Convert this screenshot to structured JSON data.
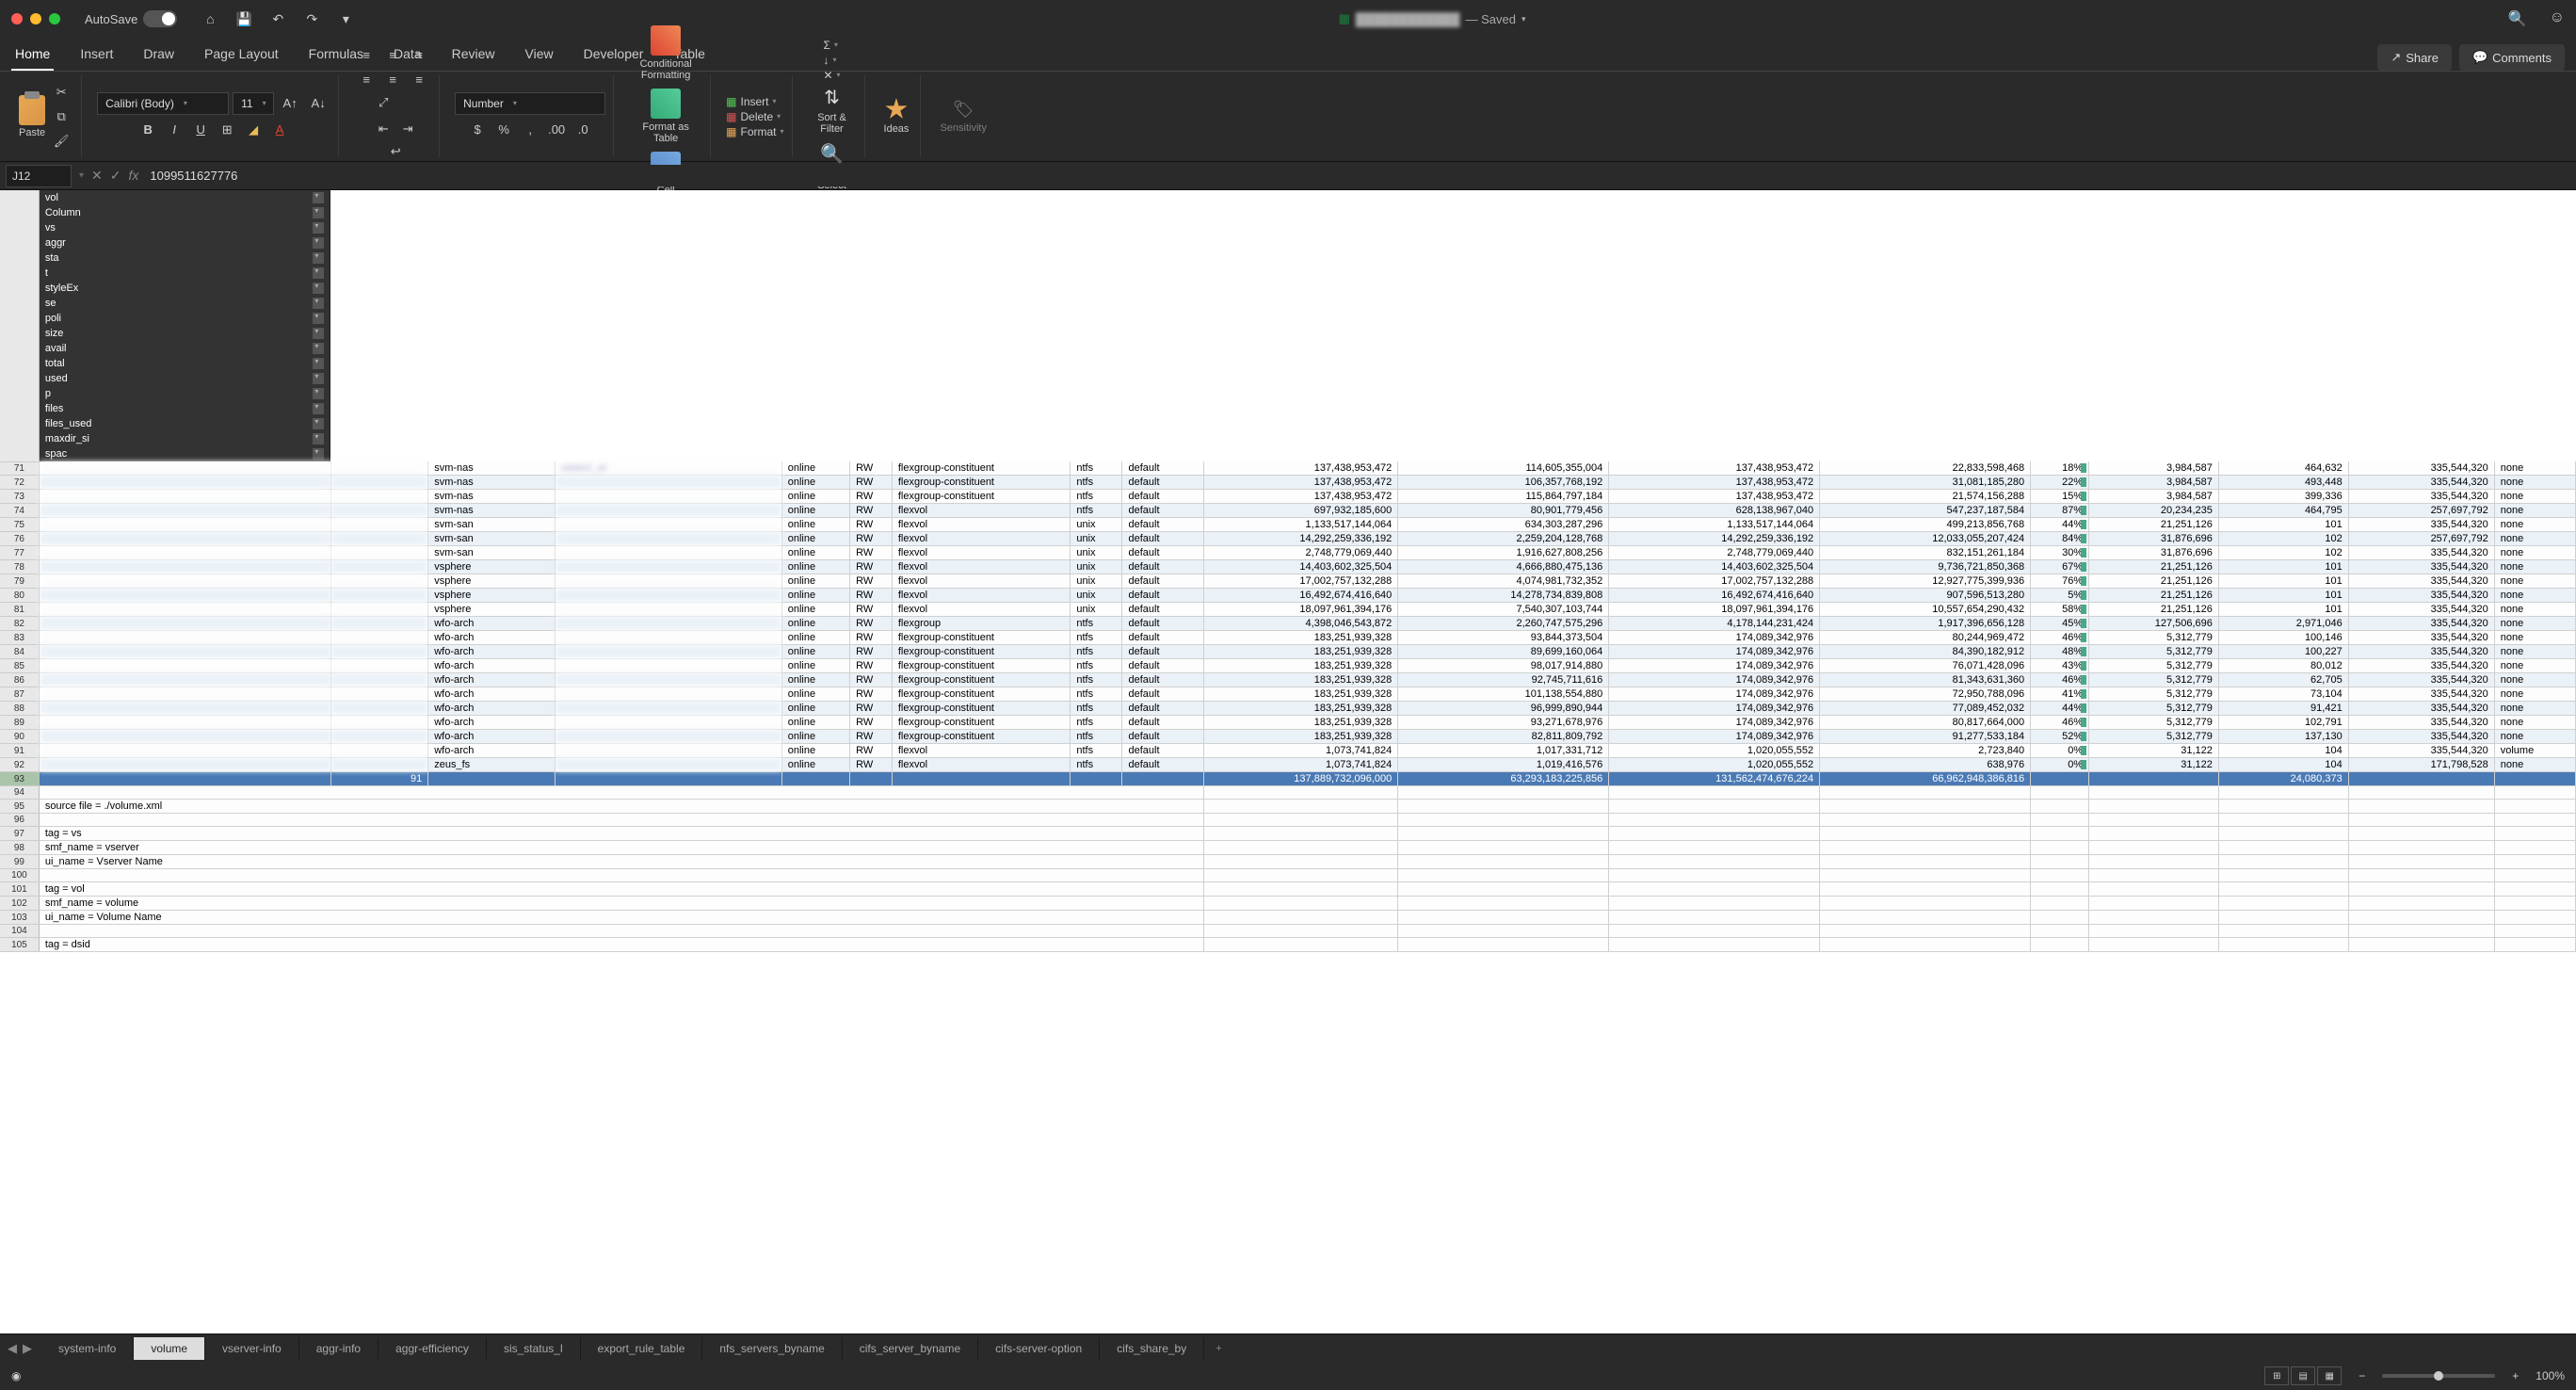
{
  "titlebar": {
    "autosave_label": "AutoSave",
    "doc_status": "— Saved"
  },
  "ribbon_tabs": [
    "Home",
    "Insert",
    "Draw",
    "Page Layout",
    "Formulas",
    "Data",
    "Review",
    "View",
    "Developer",
    "Table"
  ],
  "ribbon_right": {
    "share": "Share",
    "comments": "Comments"
  },
  "ribbon": {
    "paste": "Paste",
    "font_name": "Calibri (Body)",
    "font_size": "11",
    "number_format": "Number",
    "conditional_formatting": "Conditional Formatting",
    "format_as_table": "Format as Table",
    "cell_styles": "Cell Styles",
    "insert": "Insert",
    "delete": "Delete",
    "format": "Format",
    "sort_filter": "Sort & Filter",
    "find_select": "Find & Select",
    "ideas": "Ideas",
    "sensitivity": "Sensitivity"
  },
  "formula_bar": {
    "name_box": "J12",
    "formula": "1099511627776"
  },
  "columns": [
    "vol",
    "Column",
    "vs",
    "aggr",
    "sta",
    "t",
    "styleEx",
    "se",
    "poli",
    "size",
    "avail",
    "total",
    "used",
    "p",
    "files",
    "files_used",
    "maxdir_si",
    "spac"
  ],
  "rows": [
    {
      "n": 71,
      "vs": "svm-nas",
      "aggr": "sata02_at",
      "sta": "online",
      "t": "RW",
      "style": "flexgroup-constituent",
      "se": "ntfs",
      "poli": "default",
      "size": "137,438,953,472",
      "avail": "114,605,355,004",
      "total": "137,438,953,472",
      "used": "22,833,598,468",
      "p": "18%",
      "files": "3,984,587",
      "fu": "464,632",
      "maxdir": "335,544,320",
      "spac": "none"
    },
    {
      "n": 72,
      "vs": "svm-nas",
      "sta": "online",
      "t": "RW",
      "style": "flexgroup-constituent",
      "se": "ntfs",
      "poli": "default",
      "size": "137,438,953,472",
      "avail": "106,357,768,192",
      "total": "137,438,953,472",
      "used": "31,081,185,280",
      "p": "22%",
      "files": "3,984,587",
      "fu": "493,448",
      "maxdir": "335,544,320",
      "spac": "none"
    },
    {
      "n": 73,
      "vs": "svm-nas",
      "sta": "online",
      "t": "RW",
      "style": "flexgroup-constituent",
      "se": "ntfs",
      "poli": "default",
      "size": "137,438,953,472",
      "avail": "115,864,797,184",
      "total": "137,438,953,472",
      "used": "21,574,156,288",
      "p": "15%",
      "files": "3,984,587",
      "fu": "399,336",
      "maxdir": "335,544,320",
      "spac": "none"
    },
    {
      "n": 74,
      "vs": "svm-nas",
      "sta": "online",
      "t": "RW",
      "style": "flexvol",
      "se": "ntfs",
      "poli": "default",
      "size": "697,932,185,600",
      "avail": "80,901,779,456",
      "total": "628,138,967,040",
      "used": "547,237,187,584",
      "p": "87%",
      "files": "20,234,235",
      "fu": "464,795",
      "maxdir": "257,697,792",
      "spac": "none"
    },
    {
      "n": 75,
      "vs": "svm-san",
      "sta": "online",
      "t": "RW",
      "style": "flexvol",
      "se": "unix",
      "poli": "default",
      "size": "1,133,517,144,064",
      "avail": "634,303,287,296",
      "total": "1,133,517,144,064",
      "used": "499,213,856,768",
      "p": "44%",
      "files": "21,251,126",
      "fu": "101",
      "maxdir": "335,544,320",
      "spac": "none"
    },
    {
      "n": 76,
      "vs": "svm-san",
      "sta": "online",
      "t": "RW",
      "style": "flexvol",
      "se": "unix",
      "poli": "default",
      "size": "14,292,259,336,192",
      "avail": "2,259,204,128,768",
      "total": "14,292,259,336,192",
      "used": "12,033,055,207,424",
      "p": "84%",
      "files": "31,876,696",
      "fu": "102",
      "maxdir": "257,697,792",
      "spac": "none"
    },
    {
      "n": 77,
      "vs": "svm-san",
      "sta": "online",
      "t": "RW",
      "style": "flexvol",
      "se": "unix",
      "poli": "default",
      "size": "2,748,779,069,440",
      "avail": "1,916,627,808,256",
      "total": "2,748,779,069,440",
      "used": "832,151,261,184",
      "p": "30%",
      "files": "31,876,696",
      "fu": "102",
      "maxdir": "335,544,320",
      "spac": "none"
    },
    {
      "n": 78,
      "vs": "vsphere",
      "sta": "online",
      "t": "RW",
      "style": "flexvol",
      "se": "unix",
      "poli": "default",
      "size": "14,403,602,325,504",
      "avail": "4,666,880,475,136",
      "total": "14,403,602,325,504",
      "used": "9,736,721,850,368",
      "p": "67%",
      "files": "21,251,126",
      "fu": "101",
      "maxdir": "335,544,320",
      "spac": "none"
    },
    {
      "n": 79,
      "vs": "vsphere",
      "sta": "online",
      "t": "RW",
      "style": "flexvol",
      "se": "unix",
      "poli": "default",
      "size": "17,002,757,132,288",
      "avail": "4,074,981,732,352",
      "total": "17,002,757,132,288",
      "used": "12,927,775,399,936",
      "p": "76%",
      "files": "21,251,126",
      "fu": "101",
      "maxdir": "335,544,320",
      "spac": "none"
    },
    {
      "n": 80,
      "vs": "vsphere",
      "sta": "online",
      "t": "RW",
      "style": "flexvol",
      "se": "unix",
      "poli": "default",
      "size": "16,492,674,416,640",
      "avail": "14,278,734,839,808",
      "total": "16,492,674,416,640",
      "used": "907,596,513,280",
      "p": "5%",
      "files": "21,251,126",
      "fu": "101",
      "maxdir": "335,544,320",
      "spac": "none"
    },
    {
      "n": 81,
      "vs": "vsphere",
      "sta": "online",
      "t": "RW",
      "style": "flexvol",
      "se": "unix",
      "poli": "default",
      "size": "18,097,961,394,176",
      "avail": "7,540,307,103,744",
      "total": "18,097,961,394,176",
      "used": "10,557,654,290,432",
      "p": "58%",
      "files": "21,251,126",
      "fu": "101",
      "maxdir": "335,544,320",
      "spac": "none"
    },
    {
      "n": 82,
      "vs": "wfo-arch",
      "sta": "online",
      "t": "RW",
      "style": "flexgroup",
      "se": "ntfs",
      "poli": "default",
      "size": "4,398,046,543,872",
      "avail": "2,260,747,575,296",
      "total": "4,178,144,231,424",
      "used": "1,917,396,656,128",
      "p": "45%",
      "files": "127,506,696",
      "fu": "2,971,046",
      "maxdir": "335,544,320",
      "spac": "none"
    },
    {
      "n": 83,
      "vs": "wfo-arch",
      "sta": "online",
      "t": "RW",
      "style": "flexgroup-constituent",
      "se": "ntfs",
      "poli": "default",
      "size": "183,251,939,328",
      "avail": "93,844,373,504",
      "total": "174,089,342,976",
      "used": "80,244,969,472",
      "p": "46%",
      "files": "5,312,779",
      "fu": "100,146",
      "maxdir": "335,544,320",
      "spac": "none"
    },
    {
      "n": 84,
      "vs": "wfo-arch",
      "sta": "online",
      "t": "RW",
      "style": "flexgroup-constituent",
      "se": "ntfs",
      "poli": "default",
      "size": "183,251,939,328",
      "avail": "89,699,160,064",
      "total": "174,089,342,976",
      "used": "84,390,182,912",
      "p": "48%",
      "files": "5,312,779",
      "fu": "100,227",
      "maxdir": "335,544,320",
      "spac": "none"
    },
    {
      "n": 85,
      "vs": "wfo-arch",
      "sta": "online",
      "t": "RW",
      "style": "flexgroup-constituent",
      "se": "ntfs",
      "poli": "default",
      "size": "183,251,939,328",
      "avail": "98,017,914,880",
      "total": "174,089,342,976",
      "used": "76,071,428,096",
      "p": "43%",
      "files": "5,312,779",
      "fu": "80,012",
      "maxdir": "335,544,320",
      "spac": "none"
    },
    {
      "n": 86,
      "vs": "wfo-arch",
      "sta": "online",
      "t": "RW",
      "style": "flexgroup-constituent",
      "se": "ntfs",
      "poli": "default",
      "size": "183,251,939,328",
      "avail": "92,745,711,616",
      "total": "174,089,342,976",
      "used": "81,343,631,360",
      "p": "46%",
      "files": "5,312,779",
      "fu": "62,705",
      "maxdir": "335,544,320",
      "spac": "none"
    },
    {
      "n": 87,
      "vs": "wfo-arch",
      "sta": "online",
      "t": "RW",
      "style": "flexgroup-constituent",
      "se": "ntfs",
      "poli": "default",
      "size": "183,251,939,328",
      "avail": "101,138,554,880",
      "total": "174,089,342,976",
      "used": "72,950,788,096",
      "p": "41%",
      "files": "5,312,779",
      "fu": "73,104",
      "maxdir": "335,544,320",
      "spac": "none"
    },
    {
      "n": 88,
      "vs": "wfo-arch",
      "sta": "online",
      "t": "RW",
      "style": "flexgroup-constituent",
      "se": "ntfs",
      "poli": "default",
      "size": "183,251,939,328",
      "avail": "96,999,890,944",
      "total": "174,089,342,976",
      "used": "77,089,452,032",
      "p": "44%",
      "files": "5,312,779",
      "fu": "91,421",
      "maxdir": "335,544,320",
      "spac": "none"
    },
    {
      "n": 89,
      "vs": "wfo-arch",
      "sta": "online",
      "t": "RW",
      "style": "flexgroup-constituent",
      "se": "ntfs",
      "poli": "default",
      "size": "183,251,939,328",
      "avail": "93,271,678,976",
      "total": "174,089,342,976",
      "used": "80,817,664,000",
      "p": "46%",
      "files": "5,312,779",
      "fu": "102,791",
      "maxdir": "335,544,320",
      "spac": "none"
    },
    {
      "n": 90,
      "vs": "wfo-arch",
      "sta": "online",
      "t": "RW",
      "style": "flexgroup-constituent",
      "se": "ntfs",
      "poli": "default",
      "size": "183,251,939,328",
      "avail": "82,811,809,792",
      "total": "174,089,342,976",
      "used": "91,277,533,184",
      "p": "52%",
      "files": "5,312,779",
      "fu": "137,130",
      "maxdir": "335,544,320",
      "spac": "none"
    },
    {
      "n": 91,
      "vs": "wfo-arch",
      "sta": "online",
      "t": "RW",
      "style": "flexvol",
      "se": "ntfs",
      "poli": "default",
      "size": "1,073,741,824",
      "avail": "1,017,331,712",
      "total": "1,020,055,552",
      "used": "2,723,840",
      "p": "0%",
      "files": "31,122",
      "fu": "104",
      "maxdir": "335,544,320",
      "spac": "volume"
    },
    {
      "n": 92,
      "vs": "zeus_fs",
      "sta": "online",
      "t": "RW",
      "style": "flexvol",
      "se": "ntfs",
      "poli": "default",
      "size": "1,073,741,824",
      "avail": "1,019,416,576",
      "total": "1,020,055,552",
      "used": "638,976",
      "p": "0%",
      "files": "31,122",
      "fu": "104",
      "maxdir": "171,798,528",
      "spac": "none"
    }
  ],
  "totals": {
    "n": 93,
    "col2": "91",
    "size": "137,889,732,096,000",
    "avail": "63,293,183,225,856",
    "total": "131,562,474,676,224",
    "used": "66,962,948,386,816",
    "fu": "24,080,373"
  },
  "notes": [
    {
      "n": 94,
      "text": ""
    },
    {
      "n": 95,
      "text": "source file = ./volume.xml"
    },
    {
      "n": 96,
      "text": ""
    },
    {
      "n": 97,
      "text": "tag = vs"
    },
    {
      "n": 98,
      "text": "smf_name = vserver"
    },
    {
      "n": 99,
      "text": "ui_name = Vserver Name"
    },
    {
      "n": 100,
      "text": ""
    },
    {
      "n": 101,
      "text": "tag = vol"
    },
    {
      "n": 102,
      "text": "smf_name = volume"
    },
    {
      "n": 103,
      "text": "ui_name = Volume Name"
    },
    {
      "n": 104,
      "text": ""
    },
    {
      "n": 105,
      "text": "tag = dsid"
    }
  ],
  "sheet_tabs": [
    "system-info",
    "volume",
    "vserver-info",
    "aggr-info",
    "aggr-efficiency",
    "sis_status_l",
    "export_rule_table",
    "nfs_servers_byname",
    "cifs_server_byname",
    "cifs-server-option",
    "cifs_share_by"
  ],
  "active_sheet": "volume",
  "status_bar": {
    "zoom": "100%"
  }
}
